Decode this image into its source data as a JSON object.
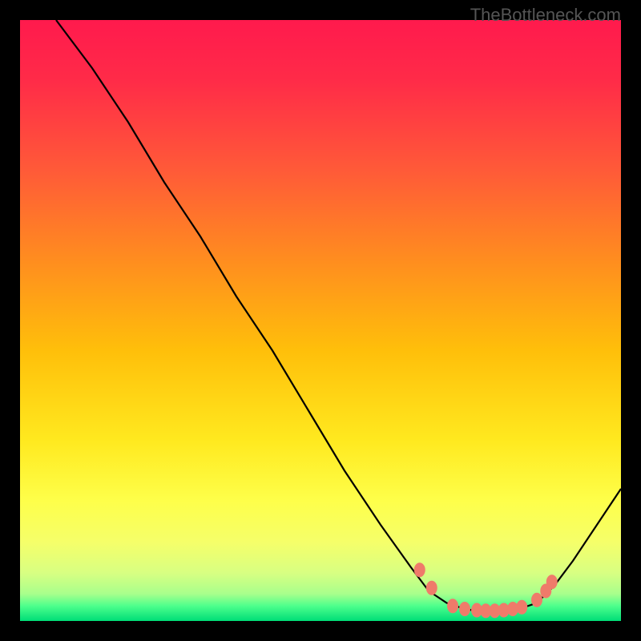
{
  "watermark": "TheBottleneck.com",
  "chart_data": {
    "type": "line",
    "title": "",
    "xlabel": "",
    "ylabel": "",
    "xlim": [
      0,
      100
    ],
    "ylim": [
      0,
      100
    ],
    "gradient_colors": {
      "top": "#ff1744",
      "upper_mid": "#ff5533",
      "mid": "#ffbb00",
      "lower_mid": "#ffee44",
      "bottom_band": "#eaff77",
      "green_band": "#00e676"
    },
    "curve": {
      "description": "V-shaped bottleneck curve descending from top-left, reaching minimum trough around x=72-85, then rising on right",
      "points_xy": [
        [
          6,
          100
        ],
        [
          12,
          92
        ],
        [
          18,
          83
        ],
        [
          24,
          73
        ],
        [
          30,
          64
        ],
        [
          36,
          54
        ],
        [
          42,
          45
        ],
        [
          48,
          35
        ],
        [
          54,
          25
        ],
        [
          60,
          16
        ],
        [
          65,
          9
        ],
        [
          68,
          5
        ],
        [
          71,
          3
        ],
        [
          74,
          2
        ],
        [
          77,
          1.5
        ],
        [
          80,
          1.5
        ],
        [
          83,
          2
        ],
        [
          86,
          3
        ],
        [
          89,
          6
        ],
        [
          92,
          10
        ],
        [
          96,
          16
        ],
        [
          100,
          22
        ]
      ]
    },
    "dots": {
      "description": "Salmon colored data point markers near the trough",
      "color": "#ef7b6a",
      "points_xy": [
        [
          66.5,
          8.5
        ],
        [
          68.5,
          5.5
        ],
        [
          72,
          2.5
        ],
        [
          74,
          2
        ],
        [
          76,
          1.8
        ],
        [
          77.5,
          1.7
        ],
        [
          79,
          1.7
        ],
        [
          80.5,
          1.8
        ],
        [
          82,
          2
        ],
        [
          83.5,
          2.3
        ],
        [
          86,
          3.5
        ],
        [
          87.5,
          5
        ],
        [
          88.5,
          6.5
        ]
      ]
    }
  }
}
